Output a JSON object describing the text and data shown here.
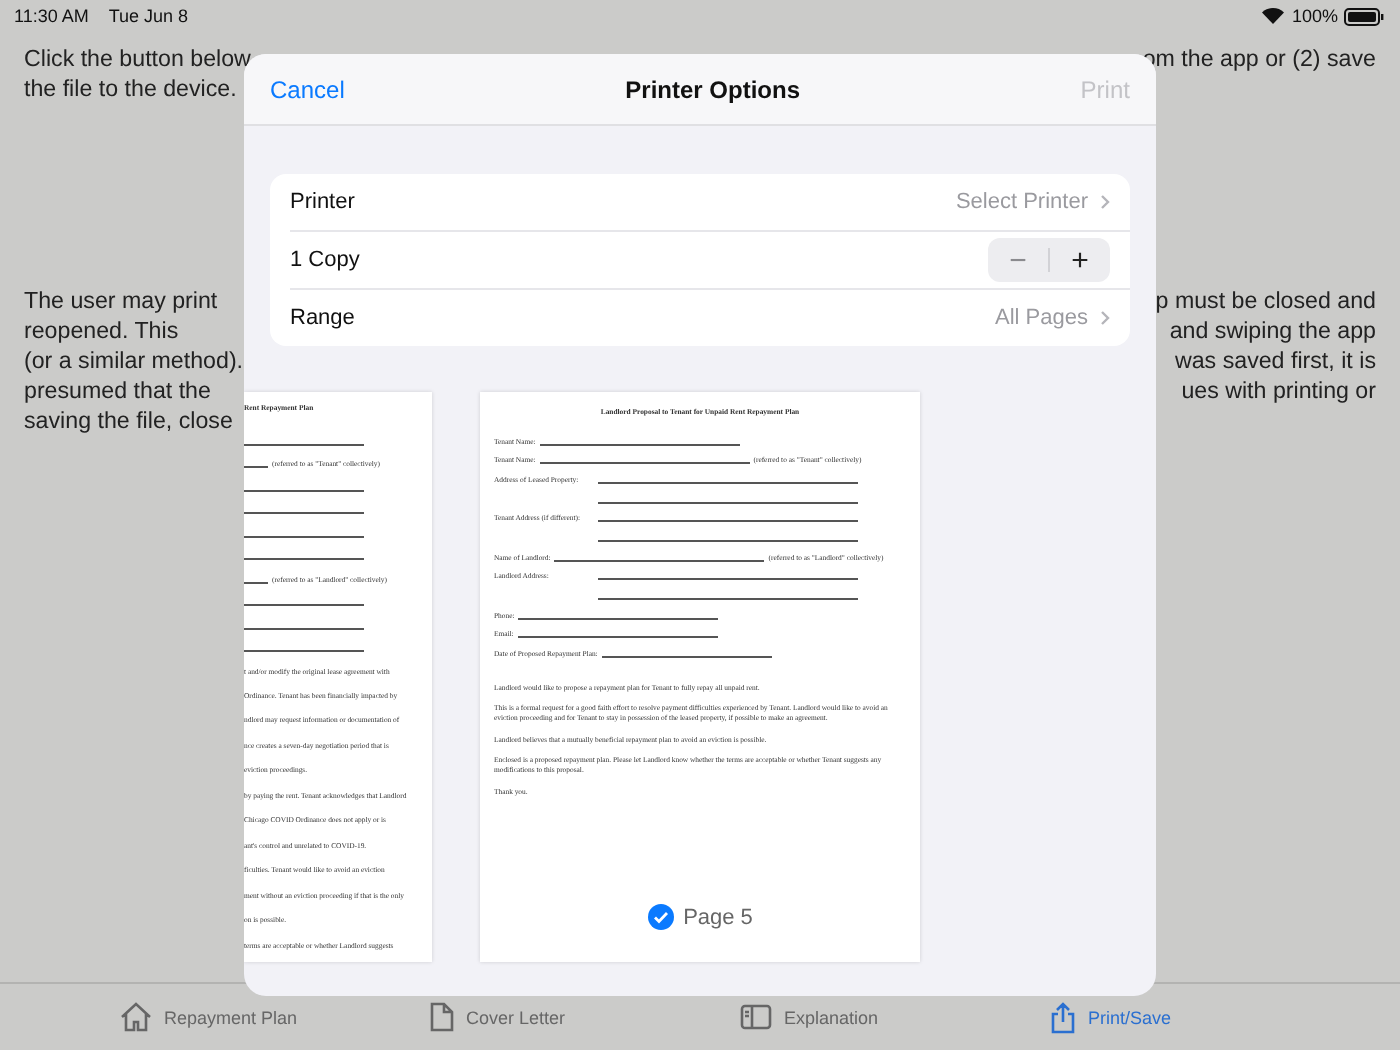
{
  "status_bar": {
    "time": "11:30 AM",
    "date": "Tue Jun 8",
    "battery": "100%"
  },
  "background": {
    "intro": [
      {
        "left": "Click the button below",
        "right": "om the app or (2) save"
      },
      {
        "left": "the file to the device."
      }
    ],
    "paragraph": [
      {
        "left": "The user may print",
        "right": "p must be closed and"
      },
      {
        "left": "reopened. This",
        "right": "and swiping the app"
      },
      {
        "left": "(or a similar method).",
        "right": "was saved first, it is"
      },
      {
        "left": "presumed that the",
        "right": "ues with printing or"
      },
      {
        "left": "saving the file, close"
      }
    ]
  },
  "dialog": {
    "cancel": "Cancel",
    "title": "Printer Options",
    "print": {
      "label": "Print",
      "disabled": true
    },
    "options": [
      {
        "kind": "link",
        "label": "Printer",
        "value": "Select Printer"
      },
      {
        "kind": "stepper",
        "label": "1 Copy",
        "minus": "−",
        "plus": "+"
      },
      {
        "kind": "link",
        "label": "Range",
        "value": "All Pages"
      }
    ],
    "previews": [
      {
        "selected": false,
        "lines": [
          {
            "kind": "title",
            "text": "Rent Repayment Plan"
          },
          {
            "kind": "blank"
          },
          {
            "kind": "suffix",
            "text": "(referred to as \"Tenant\" collectively)"
          },
          {
            "kind": "blank"
          },
          {
            "kind": "blank"
          },
          {
            "kind": "blank"
          },
          {
            "kind": "blank"
          },
          {
            "kind": "suffix",
            "text": "(referred to as \"Landlord\" collectively)"
          },
          {
            "kind": "blank"
          },
          {
            "kind": "blank"
          },
          {
            "kind": "blank"
          },
          {
            "kind": "text",
            "text": "t and/or modify the original lease agreement with"
          },
          {
            "kind": "text",
            "text": "Ordinance. Tenant has been financially impacted by"
          },
          {
            "kind": "text",
            "text": "ndlord may request information or documentation of"
          },
          {
            "kind": "text",
            "text": "nce creates a seven-day negotiation period that is"
          },
          {
            "kind": "text",
            "text": "eviction proceedings."
          },
          {
            "kind": "text",
            "text": "by paying the rent. Tenant acknowledges that Landlord"
          },
          {
            "kind": "text",
            "text": "Chicago COVID Ordinance does not apply or is"
          },
          {
            "kind": "text",
            "text": "ant's control and unrelated to COVID-19."
          },
          {
            "kind": "text",
            "text": "ficulties. Tenant would like to avoid an eviction"
          },
          {
            "kind": "text",
            "text": "ment without an eviction proceeding if that is the only"
          },
          {
            "kind": "text",
            "text": "on is possible."
          },
          {
            "kind": "text",
            "text": "terms are acceptable or whether Landlord suggests"
          }
        ]
      },
      {
        "selected": true,
        "label": "Page 5",
        "lines": [
          {
            "kind": "title",
            "text": "Landlord Proposal to Tenant for Unpaid Rent Repayment Plan"
          },
          {
            "kind": "field",
            "text": "Tenant Name:"
          },
          {
            "kind": "field",
            "text": "Tenant Name:",
            "suffix": "(referred to as \"Tenant\" collectively)"
          },
          {
            "kind": "address",
            "text": "Address of Leased Property:"
          },
          {
            "kind": "address",
            "text": "Tenant Address (if different):"
          },
          {
            "kind": "field",
            "text": "Name of Landlord:",
            "suffix": "(referred to as \"Landlord\" collectively)"
          },
          {
            "kind": "address",
            "text": "Landlord Address:"
          },
          {
            "kind": "field",
            "text": "Phone:"
          },
          {
            "kind": "field",
            "text": "Email:"
          },
          {
            "kind": "field",
            "text": "Date of Proposed Repayment Plan:"
          },
          {
            "kind": "text",
            "text": "Landlord would like to propose a repayment plan for Tenant to fully repay all unpaid rent."
          },
          {
            "kind": "text",
            "text": "This is a formal request for a good faith effort to resolve payment difficulties experienced by Tenant. Landlord would like to avoid an eviction proceeding and for Tenant to stay in possession of the leased property, if possible to make an agreement."
          },
          {
            "kind": "text",
            "text": "Landlord believes that a mutually beneficial repayment plan to avoid an eviction is possible."
          },
          {
            "kind": "text",
            "text": "Enclosed is a proposed repayment plan. Please let Landlord know whether the terms are acceptable or whether Tenant suggests any modifications to this proposal."
          },
          {
            "kind": "text",
            "text": "Thank you."
          }
        ]
      }
    ]
  },
  "tab_bar": [
    {
      "kind": "house",
      "label": "Repayment Plan",
      "selected": false
    },
    {
      "kind": "document",
      "label": "Cover Letter",
      "selected": false
    },
    {
      "kind": "sidebar",
      "label": "Explanation",
      "selected": false
    },
    {
      "kind": "share",
      "label": "Print/Save",
      "selected": true
    }
  ]
}
